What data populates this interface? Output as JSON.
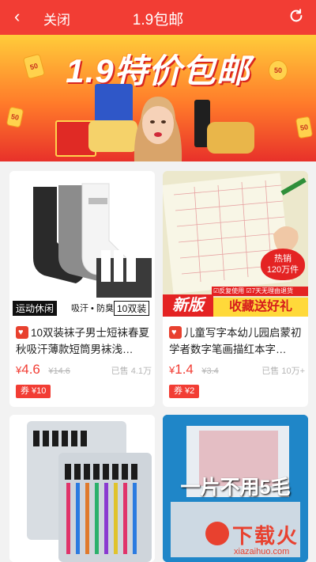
{
  "header": {
    "back_label": "关闭",
    "title": "1.9包邮"
  },
  "banner": {
    "headline": "1.9特价包邮",
    "coin_text": "50"
  },
  "products": [
    {
      "title": "10双装袜子男士短袜春夏秋吸汗薄款短筒男袜浅…",
      "price_symbol": "¥",
      "price": "4.6",
      "old_price": "¥14.6",
      "sold": "已售 4.1万",
      "coupon": "券 ¥10",
      "img_caption_left": "运动休闲",
      "img_caption_mid": "吸汗 • 防臭",
      "img_caption_right": "10双装"
    },
    {
      "title": "儿童写字本幼儿园启蒙初学者数字笔画描红本字…",
      "price_symbol": "¥",
      "price": "1.4",
      "old_price": "¥3.4",
      "sold": "已售 10万+",
      "coupon": "券 ¥2",
      "img_badge": "热销",
      "img_badge_2": "120万件",
      "img_banner_left": "新版",
      "img_banner_right": "收藏送好礼",
      "img_strip": "☑反复使用  ☑7天无理由退货"
    },
    {
      "img_caption": ""
    },
    {
      "img_caption": "一片不用5毛"
    }
  ],
  "watermark": {
    "text": "下载火",
    "url_text": "xiazaihuo.com"
  },
  "colors": {
    "primary": "#f23d34",
    "banner_top": "#ffcc3a",
    "background": "#f2f2f2"
  }
}
